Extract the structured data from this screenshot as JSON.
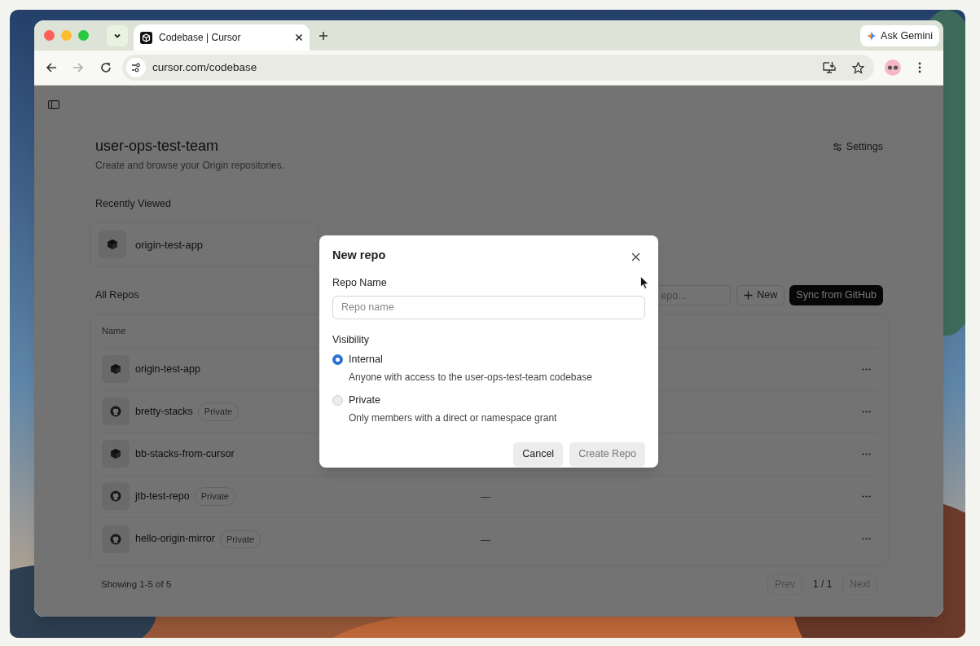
{
  "browser": {
    "tabs": [
      {
        "title": "Codebase | Cursor",
        "selected": true
      }
    ],
    "ask_button": "Ask Gemini",
    "forward_disabled": true,
    "url": "cursor.com/codebase"
  },
  "page": {
    "title": "user-ops-test-team",
    "subtitle": "Create and browse your Origin repositories.",
    "settings": "Settings",
    "recently_viewed": {
      "heading": "Recently Viewed",
      "items": [
        {
          "name": "origin-test-app",
          "kind": "origin"
        }
      ]
    },
    "all_repos": {
      "heading": "All Repos",
      "search": {
        "placeholder": "epo..."
      },
      "new_button": "New",
      "sync_button": "Sync from GitHub",
      "columns": [
        "Name"
      ],
      "rows": [
        {
          "name": "origin-test-app",
          "kind": "origin"
        },
        {
          "name": "bretty-stacks",
          "kind": "github",
          "badge": "Private"
        },
        {
          "name": "bb-stacks-from-cursor",
          "kind": "origin"
        },
        {
          "name": "jtb-test-repo",
          "kind": "github",
          "badge": "Private",
          "column_2": "—"
        },
        {
          "name": "hello-origin-mirror",
          "kind": "github",
          "badge": "Private",
          "column_2": "—"
        }
      ]
    },
    "footer": {
      "showing": "Showing 1-5 of 5",
      "prev": {
        "label": "Prev",
        "disabled": true
      },
      "page": "1 / 1",
      "next": {
        "label": "Next",
        "disabled": true
      }
    }
  },
  "modal": {
    "title": "New repo",
    "name_label": "Repo Name",
    "name_field": {
      "placeholder": "Repo name"
    },
    "visibility_label": "Visibility",
    "options": [
      {
        "label": "Internal",
        "description": "Anyone with access to the user-ops-test-team codebase",
        "selected": true
      },
      {
        "label": "Private",
        "description": "Only members with a direct or namespace grant",
        "selected": false
      }
    ],
    "buttons": [
      {
        "label": "Cancel",
        "disabled": false
      },
      {
        "label": "Create Repo",
        "disabled": true
      }
    ]
  }
}
